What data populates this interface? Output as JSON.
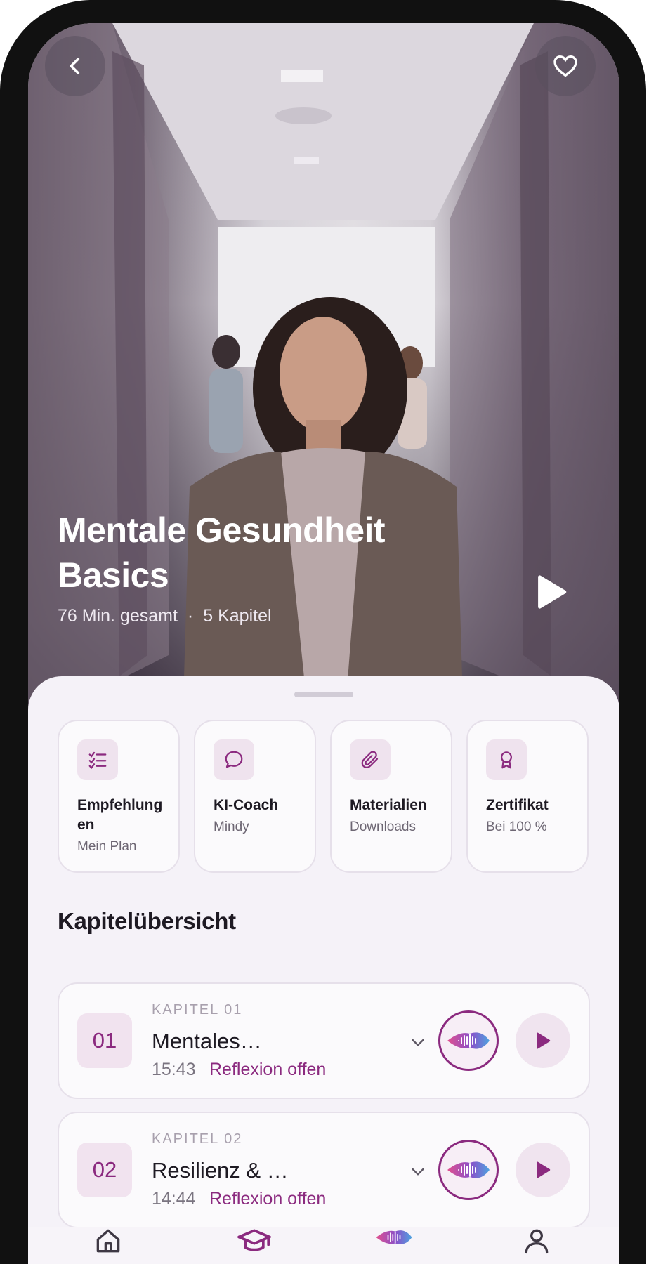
{
  "hero": {
    "title": "Mentale Gesundheit Basics",
    "duration": "76 Min. gesamt",
    "separator": "·",
    "chapters_count": "5 Kapitel"
  },
  "header": {
    "back_icon": "chevron-left-icon",
    "favorite_icon": "heart-icon"
  },
  "cards": [
    {
      "title": "Empfehlungen",
      "subtitle": "Mein Plan",
      "icon": "checklist-icon"
    },
    {
      "title": "KI-Coach",
      "subtitle": "Mindy",
      "icon": "chat-bubble-icon"
    },
    {
      "title": "Materialien",
      "subtitle": "Downloads",
      "icon": "paperclip-icon"
    },
    {
      "title": "Zertifikat",
      "subtitle": "Bei 100 %",
      "icon": "award-icon"
    }
  ],
  "section": {
    "title": "Kapitelübersicht"
  },
  "chapters": [
    {
      "number": "01",
      "label": "KAPITEL 01",
      "title": "Mentales…",
      "duration": "15:43",
      "status": "Reflexion offen"
    },
    {
      "number": "02",
      "label": "KAPITEL 02",
      "title": "Resilienz & …",
      "duration": "14:44",
      "status": "Reflexion offen"
    }
  ],
  "tabbar": [
    "home-icon",
    "graduation-cap-icon",
    "wave-logo-icon",
    "profile-icon"
  ],
  "colors": {
    "accent": "#8b2a7f",
    "sheet": "#f5f2f8",
    "card_border": "#e6e0ea"
  }
}
